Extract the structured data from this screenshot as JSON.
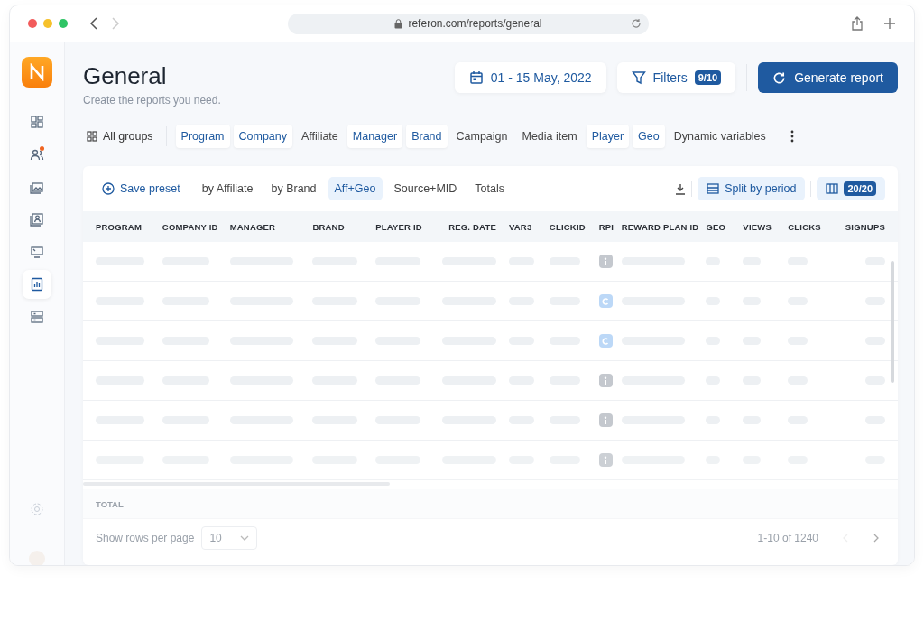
{
  "browser": {
    "url": "referon.com/reports/general"
  },
  "sidebar": {
    "items": [
      {
        "selected": false,
        "badge": false
      },
      {
        "selected": false,
        "badge": true
      },
      {
        "selected": false,
        "badge": false
      },
      {
        "selected": false,
        "badge": false
      },
      {
        "selected": false,
        "badge": false
      },
      {
        "selected": true,
        "badge": false
      },
      {
        "selected": false,
        "badge": false
      }
    ]
  },
  "header": {
    "title": "General",
    "subtitle": "Create the reports you need.",
    "date_range": "01 - 15 May, 2022",
    "filters_label": "Filters",
    "filters_count": "9/10",
    "generate_button": "Generate report"
  },
  "groups": {
    "all_label": "All groups",
    "items": [
      {
        "label": "Program",
        "selected": true
      },
      {
        "label": "Company",
        "selected": true
      },
      {
        "label": "Affiliate",
        "selected": false
      },
      {
        "label": "Manager",
        "selected": true
      },
      {
        "label": "Brand",
        "selected": true
      },
      {
        "label": "Campaign",
        "selected": false
      },
      {
        "label": "Media item",
        "selected": false
      },
      {
        "label": "Player",
        "selected": true
      },
      {
        "label": "Geo",
        "selected": true
      },
      {
        "label": "Dynamic variables",
        "selected": false
      }
    ]
  },
  "toolbar": {
    "save_preset": "Save preset",
    "presets": [
      {
        "label": "by Affiliate",
        "selected": false
      },
      {
        "label": "by Brand",
        "selected": false
      },
      {
        "label": "Aff+Geo",
        "selected": true
      },
      {
        "label": "Source+MID",
        "selected": false
      },
      {
        "label": "Totals",
        "selected": false
      }
    ],
    "split_label": "Split by period",
    "columns_count": "20/20"
  },
  "table": {
    "columns": [
      "PROGRAM",
      "COMPANY ID",
      "MANAGER",
      "BRAND",
      "PLAYER ID",
      "REG. DATE",
      "VAR3",
      "CLICKID",
      "RPI",
      "REWARD PLAN ID",
      "GEO",
      "VIEWS",
      "CLICKS",
      "SIGNUPS"
    ],
    "rows": [
      {
        "kind": "info"
      },
      {
        "kind": "c"
      },
      {
        "kind": "c"
      },
      {
        "kind": "info"
      },
      {
        "kind": "info"
      },
      {
        "kind": "info"
      }
    ],
    "total_label": "TOTAL"
  },
  "pagination": {
    "rows_label": "Show rows per page",
    "rows_value": "10",
    "range": "1-10 of 1240"
  }
}
